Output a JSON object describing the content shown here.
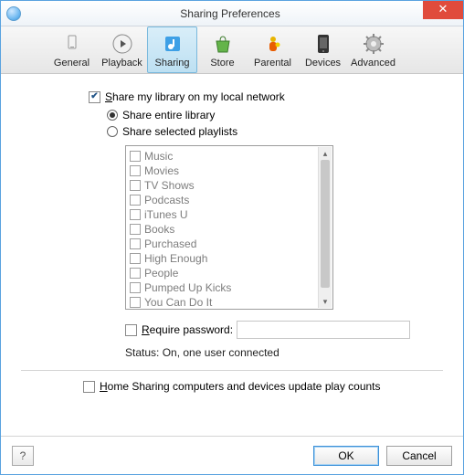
{
  "window": {
    "title": "Sharing Preferences",
    "close_glyph": "✕"
  },
  "toolbar": {
    "items": [
      {
        "id": "general",
        "label": "General"
      },
      {
        "id": "playback",
        "label": "Playback"
      },
      {
        "id": "sharing",
        "label": "Sharing"
      },
      {
        "id": "store",
        "label": "Store"
      },
      {
        "id": "parental",
        "label": "Parental"
      },
      {
        "id": "devices",
        "label": "Devices"
      },
      {
        "id": "advanced",
        "label": "Advanced"
      }
    ],
    "selected": "sharing"
  },
  "main": {
    "share_library_label_pre": "S",
    "share_library_label_post": "hare my library on my local network",
    "share_library_checked": true,
    "share_entire_label": "Share entire library",
    "share_entire_selected": true,
    "share_selected_label": "Share selected playlists",
    "share_selected_selected": false,
    "playlists": [
      "Music",
      "Movies",
      "TV Shows",
      "Podcasts",
      "iTunes U",
      "Books",
      "Purchased",
      "High Enough",
      "People",
      "Pumped Up Kicks",
      "You Can Do It"
    ],
    "require_pw_label_pre": "R",
    "require_pw_label_post": "equire password:",
    "require_pw_checked": false,
    "password_value": "",
    "status_text": "Status: On, one user connected",
    "home_sharing_label_pre": "H",
    "home_sharing_label_post": "ome Sharing computers and devices update play counts",
    "home_sharing_checked": false
  },
  "footer": {
    "help_label": "?",
    "ok_label": "OK",
    "cancel_label": "Cancel"
  }
}
